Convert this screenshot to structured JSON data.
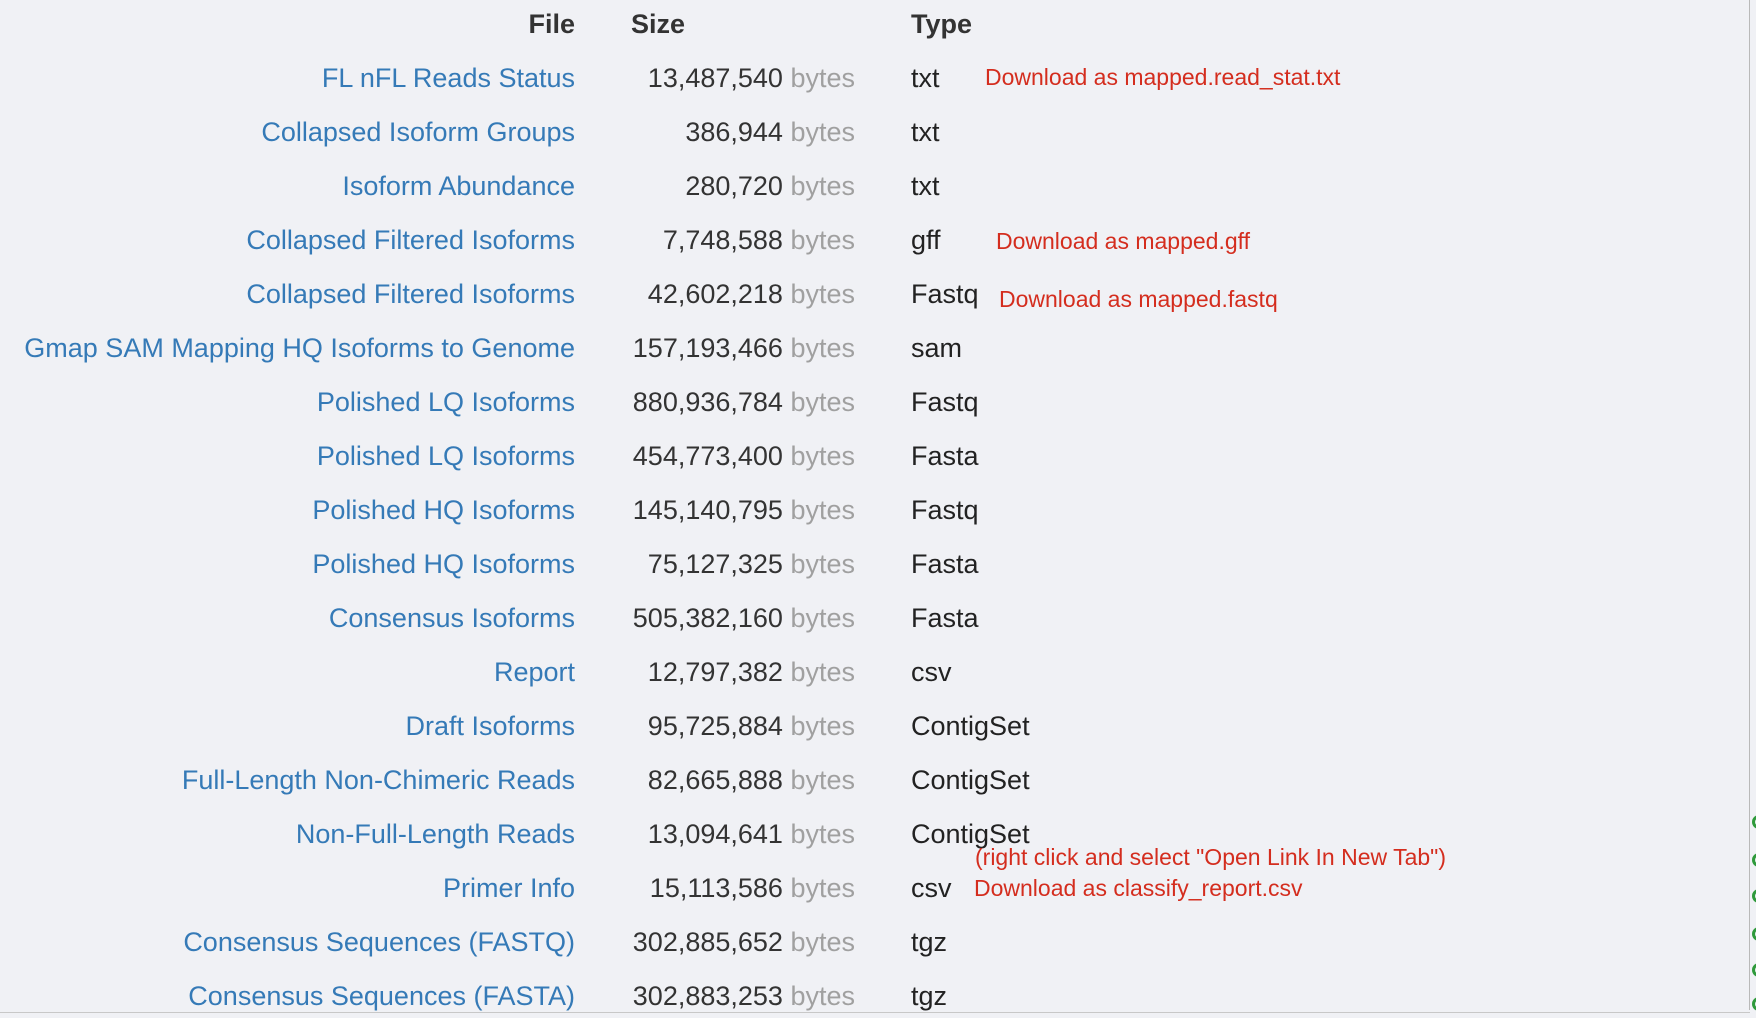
{
  "table": {
    "headers": {
      "file": "File",
      "size": "Size",
      "type": "Type"
    },
    "size_unit": "bytes",
    "rows": [
      {
        "file": "FL nFL Reads Status",
        "size": "13,487,540",
        "type": "txt",
        "note": "Download as mapped.read_stat.txt"
      },
      {
        "file": "Collapsed Isoform Groups",
        "size": "386,944",
        "type": "txt"
      },
      {
        "file": "Isoform Abundance",
        "size": "280,720",
        "type": "txt"
      },
      {
        "file": "Collapsed Filtered Isoforms",
        "size": "7,748,588",
        "type": "gff",
        "note": "Download as mapped.gff"
      },
      {
        "file": "Collapsed Filtered Isoforms",
        "size": "42,602,218",
        "type": "Fastq",
        "note": "Download as mapped.fastq"
      },
      {
        "file": "Gmap SAM Mapping HQ Isoforms to Genome",
        "size": "157,193,466",
        "type": "sam"
      },
      {
        "file": "Polished LQ Isoforms",
        "size": "880,936,784",
        "type": "Fastq"
      },
      {
        "file": "Polished LQ Isoforms",
        "size": "454,773,400",
        "type": "Fasta"
      },
      {
        "file": "Polished HQ Isoforms",
        "size": "145,140,795",
        "type": "Fastq"
      },
      {
        "file": "Polished HQ Isoforms",
        "size": "75,127,325",
        "type": "Fasta"
      },
      {
        "file": "Consensus Isoforms",
        "size": "505,382,160",
        "type": "Fasta"
      },
      {
        "file": "Report",
        "size": "12,797,382",
        "type": "csv"
      },
      {
        "file": "Draft Isoforms",
        "size": "95,725,884",
        "type": "ContigSet"
      },
      {
        "file": "Full-Length Non-Chimeric Reads",
        "size": "82,665,888",
        "type": "ContigSet"
      },
      {
        "file": "Non-Full-Length Reads",
        "size": "13,094,641",
        "type": "ContigSet"
      },
      {
        "file": "Primer Info",
        "size": "15,113,586",
        "type": "csv",
        "note": "Download as classify_report.csv"
      },
      {
        "file": "Consensus Sequences (FASTQ)",
        "size": "302,885,652",
        "type": "tgz"
      },
      {
        "file": "Consensus Sequences (FASTA)",
        "size": "302,883,253",
        "type": "tgz"
      }
    ]
  },
  "hint": "(right click and select \"Open Link In New Tab\")",
  "colors": {
    "background": "#f0f1f5",
    "link": "#357ab7",
    "annotation": "#d42d1e",
    "unit_text": "#a0a0a0",
    "edge_icon": "#2f9a3b"
  }
}
